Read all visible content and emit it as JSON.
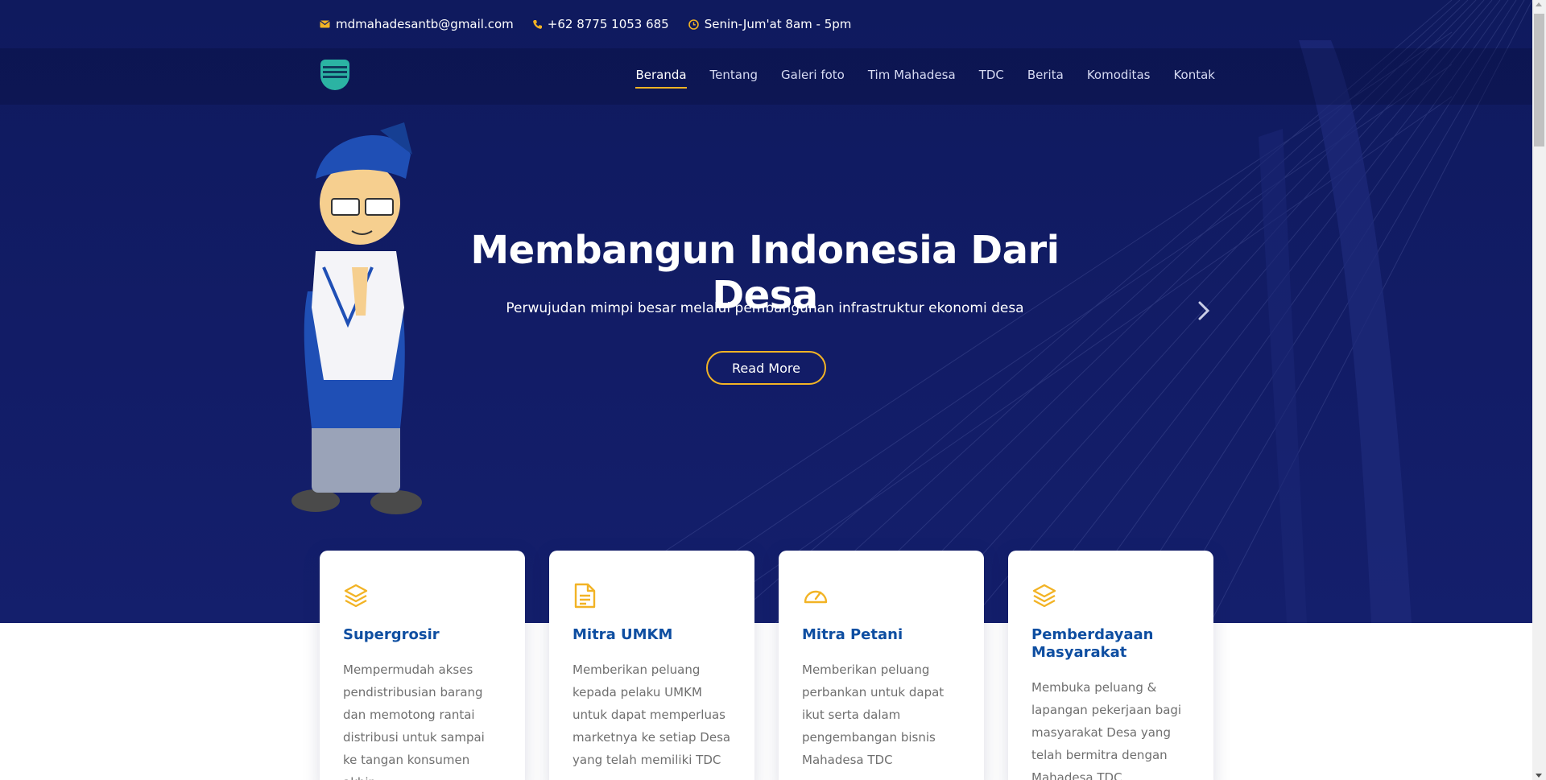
{
  "colors": {
    "hero_bg": "#121c66",
    "accent": "#f2b325",
    "card_title": "#0e4ea1",
    "card_text": "#6f6f6f"
  },
  "topbar": {
    "email": "mdmahadesantb@gmail.com",
    "phone": "+62 8775 1053 685",
    "hours": "Senin-Jum'at 8am - 5pm",
    "icons": [
      "envelope-icon",
      "phone-icon",
      "clock-icon"
    ]
  },
  "nav": {
    "active": "Beranda",
    "items": [
      "Beranda",
      "Tentang",
      "Galeri foto",
      "Tim Mahadesa",
      "TDC",
      "Berita",
      "Komoditas",
      "Kontak"
    ]
  },
  "hero": {
    "title": "Membangun Indonesia Dari Desa",
    "subtitle": "Perwujudan mimpi besar melalui pembangunan infrastruktur ekonomi desa",
    "button": "Read More",
    "next_icon": "chevron-right-icon"
  },
  "cards": [
    {
      "icon": "layers-icon",
      "title": "Supergrosir",
      "text": "Mempermudah akses pendistribusian barang dan memotong rantai distribusi untuk sampai ke tangan konsumen akhir"
    },
    {
      "icon": "document-icon",
      "title": "Mitra UMKM",
      "text": "Memberikan peluang kepada pelaku UMKM untuk dapat memperluas marketnya ke setiap Desa yang telah memiliki TDC"
    },
    {
      "icon": "speedometer-icon",
      "title": "Mitra Petani",
      "text": "Memberikan peluang perbankan untuk dapat ikut serta dalam pengembangan bisnis Mahadesa TDC"
    },
    {
      "icon": "layers-icon",
      "title": "Pemberdayaan Masyarakat",
      "text": "Membuka peluang & lapangan pekerjaan bagi masyarakat Desa yang telah bermitra dengan Mahadesa TDC"
    }
  ]
}
